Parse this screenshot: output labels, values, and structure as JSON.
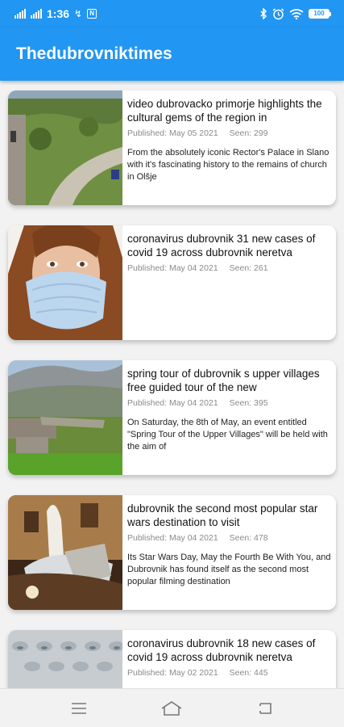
{
  "status_bar": {
    "time": "1:36",
    "battery": "100",
    "nfc_label": "N",
    "icons": [
      "signal-icon",
      "signal-icon",
      "usb-icon",
      "nfc-icon",
      "bluetooth-icon",
      "alarm-icon",
      "wifi-icon",
      "battery-icon"
    ]
  },
  "app_bar": {
    "title": "Thedubrovniktimes"
  },
  "colors": {
    "primary": "#2196f3"
  },
  "articles": [
    {
      "title": "video dubrovacko primorje highlights the cultural gems of the region in",
      "published": "Published: May 05 2021",
      "seen": "Seen: 299",
      "excerpt": "From the absolutely iconic Rector's Palace in Slano with it's fascinating history to the remains of church in Olšje"
    },
    {
      "title": "coronavirus dubrovnik 31 new cases of covid 19 across dubrovnik neretva",
      "published": "Published: May 04 2021",
      "seen": "Seen: 261",
      "excerpt": ""
    },
    {
      "title": "spring tour of dubrovnik s upper villages free guided tour of the new",
      "published": "Published: May 04 2021",
      "seen": "Seen: 395",
      "excerpt": "On Saturday, the 8th of May, an event entitled \"Spring Tour of the Upper Villages\" will be held with the aim of"
    },
    {
      "title": "dubrovnik the second most popular star wars destination to visit",
      "published": "Published: May 04 2021",
      "seen": "Seen: 478",
      "excerpt": "Its Star Wars Day, May the Fourth Be With You, and Dubrovnik has found itself as the second most popular filming destination"
    },
    {
      "title": "coronavirus dubrovnik 18 new cases of covid 19 across dubrovnik neretva",
      "published": "Published: May 02 2021",
      "seen": "Seen: 445",
      "excerpt": ""
    }
  ],
  "nav_bar": {
    "icons": [
      "menu-icon",
      "home-icon",
      "back-icon"
    ]
  }
}
